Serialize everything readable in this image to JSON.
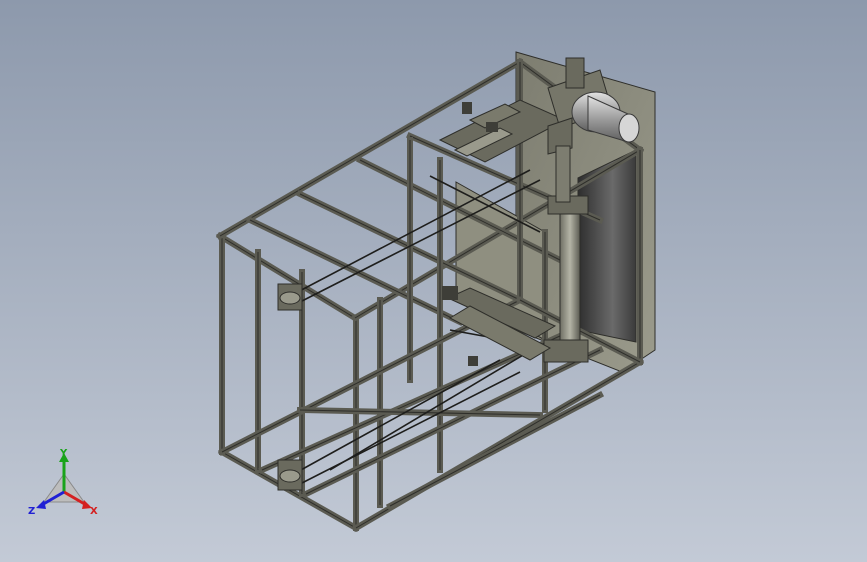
{
  "viewport": {
    "background_top": "#8d99ac",
    "background_bottom": "#c3cad6",
    "frame_color": "#5b5b52",
    "frame_edge": "#2e2e2a",
    "panel_color": "#8a8a7c",
    "motor_color": "#b8b8b8"
  },
  "triad": {
    "y_label": "Y",
    "x_label": "X",
    "z_label": "Z",
    "y_color": "#1aa31a",
    "x_color": "#d42020",
    "z_color": "#2020d4"
  }
}
